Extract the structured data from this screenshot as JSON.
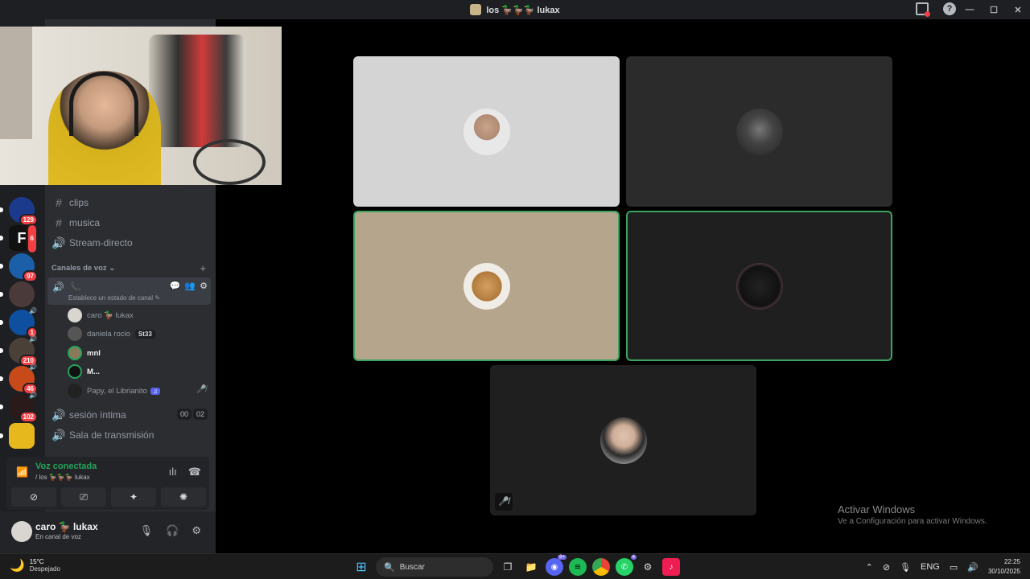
{
  "window": {
    "title": "los 🦆🦆🦆 lukax",
    "help": "?"
  },
  "window_controls": {
    "minimize": "—",
    "maximize": "☐",
    "close": "✕"
  },
  "servers": [
    {
      "badge": "129"
    },
    {
      "letter": "F",
      "badge": "6"
    },
    {
      "badge": "97"
    },
    {
      "badge": ""
    },
    {
      "badge": "1"
    },
    {
      "badge": "210"
    },
    {
      "badge": "46"
    },
    {
      "badge": "102"
    },
    {
      "badge": ""
    }
  ],
  "channels": {
    "text": [
      {
        "name": "clips"
      },
      {
        "name": "musica"
      }
    ],
    "stream_directo": "Stream-directo",
    "voice_category": "Canales de voz",
    "active_voice_status": "Establece un estado de canal",
    "members": [
      {
        "name": "caro 🦆 lukax"
      },
      {
        "name": "daniela rocio",
        "tag": "St33"
      },
      {
        "name": "mnl"
      },
      {
        "name": "M..."
      },
      {
        "name": "Papy, el Librianito",
        "tag": "♫"
      }
    ],
    "other_voice": [
      {
        "name": "sesión íntima",
        "count_a": "00",
        "count_b": "02"
      },
      {
        "name": "Sala de transmisión"
      }
    ]
  },
  "voice_panel": {
    "status": "Voz conectada",
    "channel": "/ los 🦆🦆🦆 lukax"
  },
  "user": {
    "name": "caro 🦆 lukax",
    "status": "En canal de voz"
  },
  "activation": {
    "title": "Activar Windows",
    "subtitle": "Ve a Configuración para activar Windows."
  },
  "taskbar": {
    "weather_temp": "15°C",
    "weather_desc": "Despejado",
    "search": "Buscar",
    "discord_badge": "9+",
    "whatsapp_badge": "4",
    "lang": "ENG",
    "time": "22:25",
    "date": "30/10/2025"
  },
  "colors": {
    "accent_green": "#23a55a",
    "danger_red": "#f23f43",
    "speaking_border": "#3ba55d"
  }
}
